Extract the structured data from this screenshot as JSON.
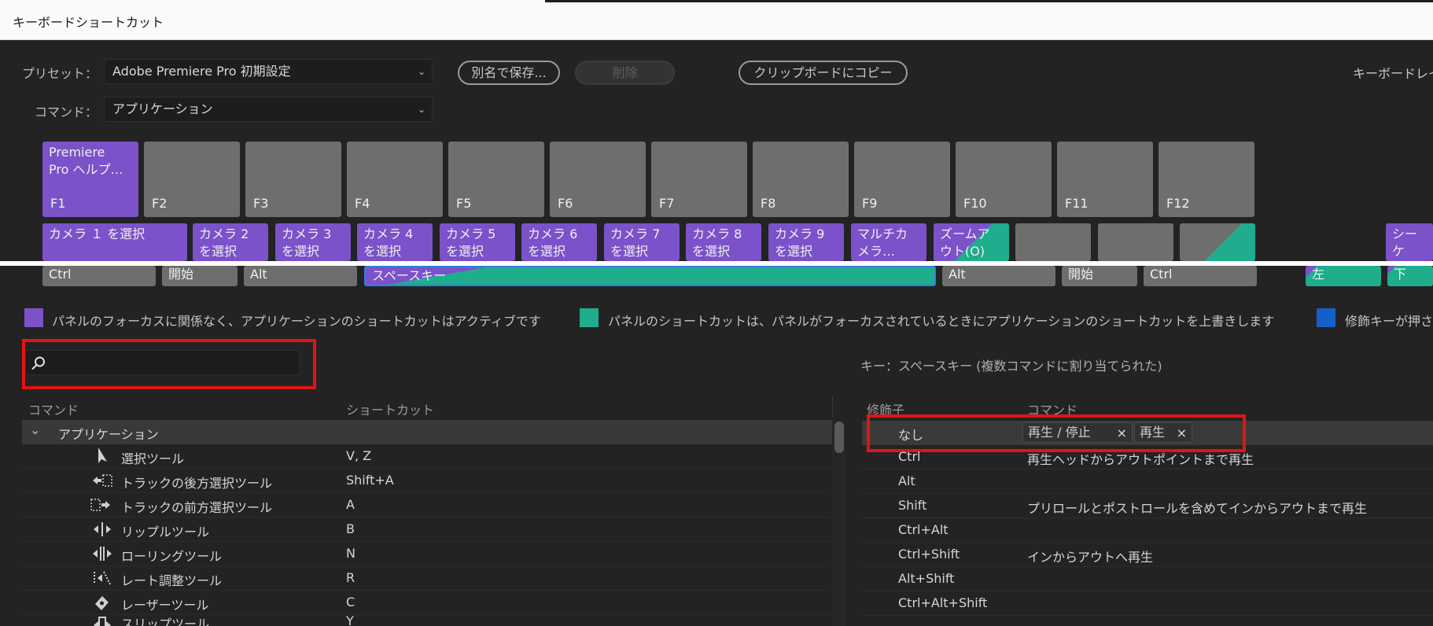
{
  "window": {
    "title": "キーボードショートカット"
  },
  "preset": {
    "label": "プリセット：",
    "value": "Adobe Premiere Pro 初期設定"
  },
  "command": {
    "label": "コマンド：",
    "value": "アプリケーション"
  },
  "buttons": {
    "save_as": "別名で保存...",
    "delete": "削除",
    "copy_clipboard": "クリップボードにコピー",
    "keyboard_layout": "キーボードレイ"
  },
  "fkeys": [
    {
      "label": "F1",
      "action": "Premiere\nPro ヘルプ…",
      "color": "purple"
    },
    {
      "label": "F2"
    },
    {
      "label": "F3"
    },
    {
      "label": "F4"
    },
    {
      "label": "F5"
    },
    {
      "label": "F6"
    },
    {
      "label": "F7"
    },
    {
      "label": "F8"
    },
    {
      "label": "F9"
    },
    {
      "label": "F10"
    },
    {
      "label": "F11"
    },
    {
      "label": "F12"
    }
  ],
  "numkeys": [
    {
      "text": "カメラ １ を選択"
    },
    {
      "text": "カメラ 2\nを選択"
    },
    {
      "text": "カメラ 3\nを選択"
    },
    {
      "text": "カメラ 4\nを選択"
    },
    {
      "text": "カメラ 5\nを選択"
    },
    {
      "text": "カメラ 6\nを選択"
    },
    {
      "text": "カメラ 7\nを選択"
    },
    {
      "text": "カメラ 8\nを選択"
    },
    {
      "text": "カメラ 9\nを選択"
    },
    {
      "text": "マルチカ\nメラ…"
    },
    {
      "text": "ズームア\nウト(O)"
    },
    {
      "text": ""
    },
    {
      "text": ""
    },
    {
      "text": ""
    },
    {
      "text": "シーケ\nスま…"
    }
  ],
  "bottom_keys": {
    "ctrl_left": "Ctrl",
    "start_left": "開始",
    "alt_left": "Alt",
    "space": "スペースキー",
    "alt_right": "Alt",
    "start_right": "開始",
    "ctrl_right": "Ctrl",
    "left": "左",
    "down": "下"
  },
  "legend": {
    "app": "パネルのフォーカスに関係なく、アプリケーションのショートカットはアクティブです",
    "panel": "パネルのショートカットは、パネルがフォーカスされているときにアプリケーションのショートカットを上書きします",
    "modifier": "修飾キーが押さ",
    "colors": {
      "app": "#7b52c9",
      "panel": "#1fad8d",
      "modifier": "#1560c8"
    }
  },
  "search": {
    "placeholder": ""
  },
  "left_table": {
    "col_command": "コマンド",
    "col_shortcut": "ショートカット",
    "group": "アプリケーション",
    "rows": [
      {
        "command": "選択ツール",
        "shortcut": "V, Z",
        "icon": "selection-tool-icon"
      },
      {
        "command": "トラックの後方選択ツール",
        "shortcut": "Shift+A",
        "icon": "track-select-backward-icon"
      },
      {
        "command": "トラックの前方選択ツール",
        "shortcut": "A",
        "icon": "track-select-forward-icon"
      },
      {
        "command": "リップルツール",
        "shortcut": "B",
        "icon": "ripple-edit-icon"
      },
      {
        "command": "ローリングツール",
        "shortcut": "N",
        "icon": "rolling-edit-icon"
      },
      {
        "command": "レート調整ツール",
        "shortcut": "R",
        "icon": "rate-stretch-icon"
      },
      {
        "command": "レーザーツール",
        "shortcut": "C",
        "icon": "razor-tool-icon"
      },
      {
        "command": "スリップツール",
        "shortcut": "Y",
        "icon": "slip-tool-icon"
      }
    ]
  },
  "right_panel": {
    "key_info": "キー：スペースキー (複数コマンドに割り当てられた)",
    "col_modifier": "修飾子",
    "col_command": "コマンド",
    "chips": [
      "再生 / 停止",
      "再生"
    ],
    "rows": [
      {
        "modifier": "なし",
        "command": ""
      },
      {
        "modifier": "Ctrl",
        "command": "再生ヘッドからアウトポイントまで再生"
      },
      {
        "modifier": "Alt",
        "command": ""
      },
      {
        "modifier": "Shift",
        "command": "プリロールとポストロールを含めてインからアウトまで再生"
      },
      {
        "modifier": "Ctrl+Alt",
        "command": ""
      },
      {
        "modifier": "Ctrl+Shift",
        "command": "インからアウトへ再生"
      },
      {
        "modifier": "Alt+Shift",
        "command": ""
      },
      {
        "modifier": "Ctrl+Alt+Shift",
        "command": ""
      }
    ]
  }
}
